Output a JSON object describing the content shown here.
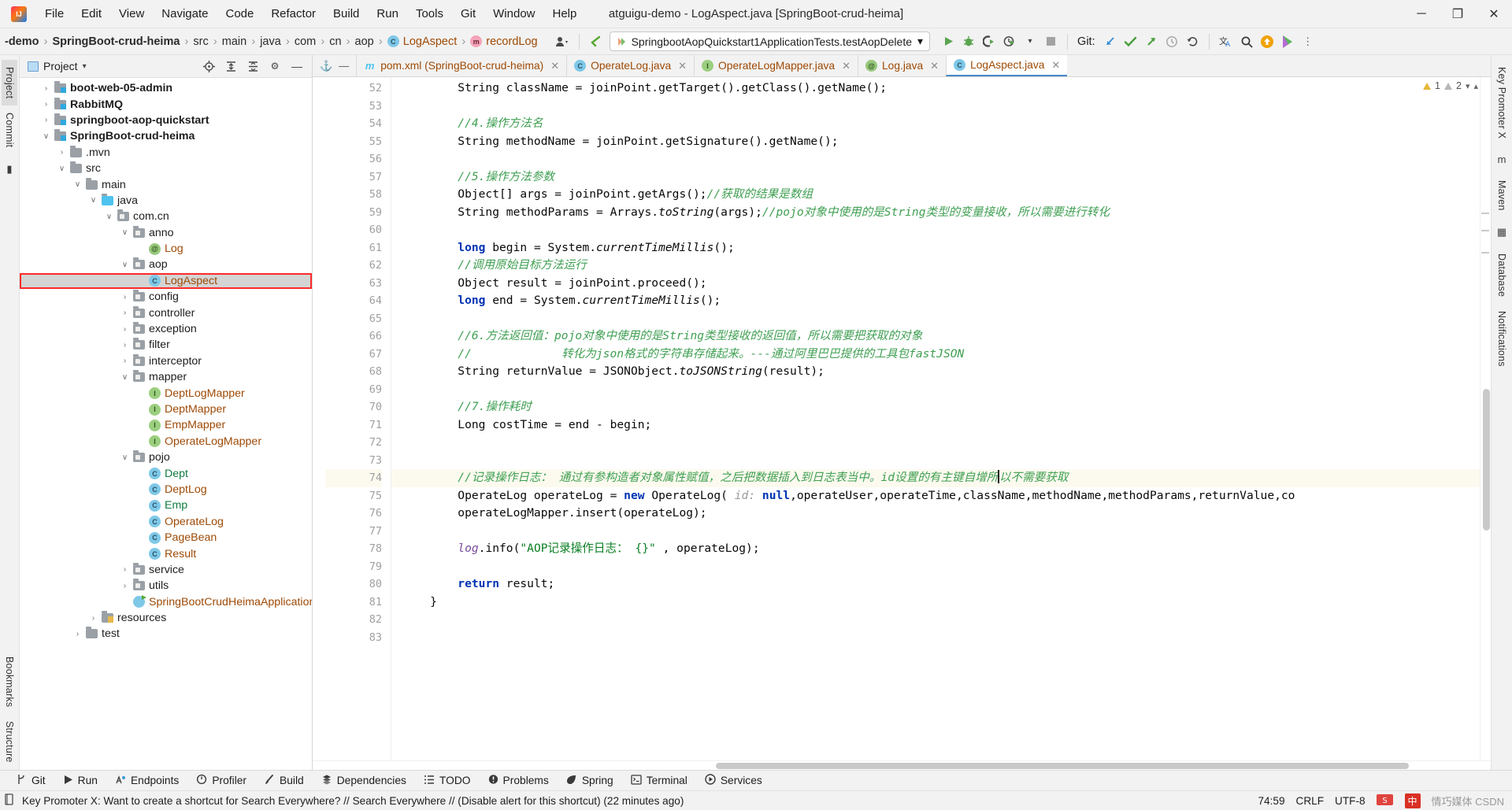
{
  "window": {
    "title": "atguigu-demo - LogAspect.java [SpringBoot-crud-heima]",
    "logo": "intellij-idea-logo",
    "controls": {
      "minimize": "─",
      "maximize": "❐",
      "close": "✕"
    }
  },
  "menubar": [
    "File",
    "Edit",
    "View",
    "Navigate",
    "Code",
    "Refactor",
    "Build",
    "Run",
    "Tools",
    "Git",
    "Window",
    "Help"
  ],
  "navbar": {
    "breadcrumbs": [
      {
        "label": "-demo",
        "bold": true,
        "icon": ""
      },
      {
        "label": "SpringBoot-crud-heima",
        "bold": true,
        "icon": ""
      },
      {
        "label": "src",
        "bold": false,
        "icon": ""
      },
      {
        "label": "main",
        "bold": false,
        "icon": ""
      },
      {
        "label": "java",
        "bold": false,
        "icon": ""
      },
      {
        "label": "com",
        "bold": false,
        "icon": ""
      },
      {
        "label": "cn",
        "bold": false,
        "icon": ""
      },
      {
        "label": "aop",
        "bold": false,
        "icon": ""
      },
      {
        "label": "LogAspect",
        "bold": false,
        "icon": "class-badge",
        "orange": true
      },
      {
        "label": "recordLog",
        "bold": false,
        "icon": "method-badge",
        "orange": true
      }
    ],
    "run_config": "SpringbootAopQuickstart1ApplicationTests.testAopDelete",
    "run_config_dropdown": "▾",
    "actions": [
      "run-icon",
      "debug-icon",
      "run-coverage-icon",
      "profiler-icon",
      "stop-icon"
    ],
    "git_label": "Git:",
    "git_actions": [
      "update-project-icon",
      "commit-icon",
      "push-icon",
      "history-icon",
      "rollback-icon"
    ],
    "right_actions": [
      "translate-icon",
      "search-everywhere-icon",
      "update-badge-icon",
      "ai-assistant-icon"
    ],
    "settings_icons": [
      "avatar-icon",
      "back-arrow-icon"
    ]
  },
  "left_rail": [
    "Project",
    "Commit"
  ],
  "left_rail_bottom": [
    "Bookmarks",
    "Structure"
  ],
  "right_rail": [
    "Key Promoter X",
    "Maven",
    "Database",
    "Notifications"
  ],
  "project_panel": {
    "title": "Project",
    "title_dropdown": "▾",
    "header_actions": [
      "locate-icon",
      "expand-all-icon",
      "collapse-all-icon",
      "settings-icon",
      "hide-icon"
    ],
    "tree": [
      {
        "depth": 1,
        "arrow": "›",
        "icon": "module",
        "label": "boot-web-05-admin",
        "bold": true
      },
      {
        "depth": 1,
        "arrow": "›",
        "icon": "module",
        "label": "RabbitMQ",
        "bold": true
      },
      {
        "depth": 1,
        "arrow": "›",
        "icon": "module",
        "label": "springboot-aop-quickstart",
        "bold": true
      },
      {
        "depth": 1,
        "arrow": "∨",
        "icon": "module",
        "label": "SpringBoot-crud-heima",
        "bold": true
      },
      {
        "depth": 2,
        "arrow": "›",
        "icon": "folder",
        "label": ".mvn"
      },
      {
        "depth": 2,
        "arrow": "∨",
        "icon": "folder",
        "label": "src"
      },
      {
        "depth": 3,
        "arrow": "∨",
        "icon": "folder",
        "label": "main"
      },
      {
        "depth": 4,
        "arrow": "∨",
        "icon": "source-folder",
        "label": "java"
      },
      {
        "depth": 5,
        "arrow": "∨",
        "icon": "package",
        "label": "com.cn"
      },
      {
        "depth": 6,
        "arrow": "∨",
        "icon": "package",
        "label": "anno"
      },
      {
        "depth": 7,
        "arrow": "",
        "icon": "annotation",
        "label": "Log",
        "color": "orange"
      },
      {
        "depth": 6,
        "arrow": "∨",
        "icon": "package",
        "label": "aop"
      },
      {
        "depth": 7,
        "arrow": "",
        "icon": "class",
        "label": "LogAspect",
        "color": "orange",
        "selected": true,
        "boxed": true
      },
      {
        "depth": 6,
        "arrow": "›",
        "icon": "package",
        "label": "config"
      },
      {
        "depth": 6,
        "arrow": "›",
        "icon": "package",
        "label": "controller"
      },
      {
        "depth": 6,
        "arrow": "›",
        "icon": "package",
        "label": "exception"
      },
      {
        "depth": 6,
        "arrow": "›",
        "icon": "package",
        "label": "filter"
      },
      {
        "depth": 6,
        "arrow": "›",
        "icon": "package",
        "label": "interceptor"
      },
      {
        "depth": 6,
        "arrow": "∨",
        "icon": "package",
        "label": "mapper"
      },
      {
        "depth": 7,
        "arrow": "",
        "icon": "interface",
        "label": "DeptLogMapper",
        "color": "orange"
      },
      {
        "depth": 7,
        "arrow": "",
        "icon": "interface",
        "label": "DeptMapper",
        "color": "orange"
      },
      {
        "depth": 7,
        "arrow": "",
        "icon": "interface",
        "label": "EmpMapper",
        "color": "orange"
      },
      {
        "depth": 7,
        "arrow": "",
        "icon": "interface",
        "label": "OperateLogMapper",
        "color": "orange"
      },
      {
        "depth": 6,
        "arrow": "∨",
        "icon": "package",
        "label": "pojo"
      },
      {
        "depth": 7,
        "arrow": "",
        "icon": "class",
        "label": "Dept",
        "color": "green"
      },
      {
        "depth": 7,
        "arrow": "",
        "icon": "class",
        "label": "DeptLog",
        "color": "orange"
      },
      {
        "depth": 7,
        "arrow": "",
        "icon": "class",
        "label": "Emp",
        "color": "green"
      },
      {
        "depth": 7,
        "arrow": "",
        "icon": "class",
        "label": "OperateLog",
        "color": "orange"
      },
      {
        "depth": 7,
        "arrow": "",
        "icon": "class",
        "label": "PageBean",
        "color": "orange"
      },
      {
        "depth": 7,
        "arrow": "",
        "icon": "class",
        "label": "Result",
        "color": "orange"
      },
      {
        "depth": 6,
        "arrow": "›",
        "icon": "package",
        "label": "service"
      },
      {
        "depth": 6,
        "arrow": "›",
        "icon": "package",
        "label": "utils"
      },
      {
        "depth": 6,
        "arrow": "",
        "icon": "spring-class",
        "label": "SpringBootCrudHeimaApplication",
        "color": "orange"
      },
      {
        "depth": 4,
        "arrow": "›",
        "icon": "resource-folder",
        "label": "resources"
      },
      {
        "depth": 3,
        "arrow": "›",
        "icon": "folder",
        "label": "test"
      }
    ]
  },
  "editor": {
    "tabs": [
      {
        "label": "pom.xml (SpringBoot-crud-heima)",
        "icon": "maven",
        "active": false,
        "close": "✕"
      },
      {
        "label": "OperateLog.java",
        "icon": "class",
        "active": false,
        "close": "✕"
      },
      {
        "label": "OperateLogMapper.java",
        "icon": "interface",
        "active": false,
        "close": "✕"
      },
      {
        "label": "Log.java",
        "icon": "annotation",
        "active": false,
        "close": "✕"
      },
      {
        "label": "LogAspect.java",
        "icon": "class",
        "active": true,
        "close": "✕"
      }
    ],
    "inspection": {
      "warnings": "1",
      "weak_warnings": "2",
      "warn_icon": "warning-triangle-icon",
      "weak_icon": "weak-warning-icon"
    },
    "first_line_number": 52,
    "current_line": 74,
    "lines": [
      {
        "n": 52,
        "segments": [
          {
            "t": "        String className = joinPoint.getTarget().getClass().getName();",
            "c": ""
          }
        ]
      },
      {
        "n": 53,
        "segments": [
          {
            "t": "",
            "c": ""
          }
        ]
      },
      {
        "n": 54,
        "segments": [
          {
            "t": "        ",
            "c": ""
          },
          {
            "t": "//4.操作方法名",
            "c": "cm"
          }
        ]
      },
      {
        "n": 55,
        "segments": [
          {
            "t": "        String methodName = joinPoint.getSignature().getName();",
            "c": ""
          }
        ]
      },
      {
        "n": 56,
        "segments": [
          {
            "t": "",
            "c": ""
          }
        ]
      },
      {
        "n": 57,
        "segments": [
          {
            "t": "        ",
            "c": ""
          },
          {
            "t": "//5.操作方法参数",
            "c": "cm"
          }
        ]
      },
      {
        "n": 58,
        "segments": [
          {
            "t": "        Object[] args = joinPoint.getArgs();",
            "c": ""
          },
          {
            "t": "//获取的结果是数组",
            "c": "cm"
          }
        ]
      },
      {
        "n": 59,
        "segments": [
          {
            "t": "        String methodParams = Arrays.",
            "c": ""
          },
          {
            "t": "toString",
            "c": "it"
          },
          {
            "t": "(args);",
            "c": ""
          },
          {
            "t": "//pojo对象中使用的是String类型的变量接收，所以需要进行转化",
            "c": "cm"
          }
        ]
      },
      {
        "n": 60,
        "segments": [
          {
            "t": "",
            "c": ""
          }
        ]
      },
      {
        "n": 61,
        "segments": [
          {
            "t": "        ",
            "c": ""
          },
          {
            "t": "long",
            "c": "kw"
          },
          {
            "t": " begin = System.",
            "c": ""
          },
          {
            "t": "currentTimeMillis",
            "c": "it"
          },
          {
            "t": "();",
            "c": ""
          }
        ]
      },
      {
        "n": 62,
        "segments": [
          {
            "t": "        ",
            "c": ""
          },
          {
            "t": "//调用原始目标方法运行",
            "c": "cm"
          }
        ]
      },
      {
        "n": 63,
        "segments": [
          {
            "t": "        Object result = joinPoint.proceed();",
            "c": ""
          }
        ]
      },
      {
        "n": 64,
        "segments": [
          {
            "t": "        ",
            "c": ""
          },
          {
            "t": "long",
            "c": "kw"
          },
          {
            "t": " end = System.",
            "c": ""
          },
          {
            "t": "currentTimeMillis",
            "c": "it"
          },
          {
            "t": "();",
            "c": ""
          }
        ]
      },
      {
        "n": 65,
        "segments": [
          {
            "t": "",
            "c": ""
          }
        ]
      },
      {
        "n": 66,
        "segments": [
          {
            "t": "        ",
            "c": ""
          },
          {
            "t": "//6.方法返回值：pojo对象中使用的是String类型接收的返回值，所以需要把获取的对象",
            "c": "cm"
          }
        ]
      },
      {
        "n": 67,
        "segments": [
          {
            "t": "        ",
            "c": ""
          },
          {
            "t": "//             转化为json格式的字符串存储起来。---通过阿里巴巴提供的工具包fastJSON",
            "c": "cm"
          }
        ]
      },
      {
        "n": 68,
        "segments": [
          {
            "t": "        String returnValue = JSONObject.",
            "c": ""
          },
          {
            "t": "toJSONString",
            "c": "it"
          },
          {
            "t": "(result);",
            "c": ""
          }
        ]
      },
      {
        "n": 69,
        "segments": [
          {
            "t": "",
            "c": ""
          }
        ]
      },
      {
        "n": 70,
        "segments": [
          {
            "t": "        ",
            "c": ""
          },
          {
            "t": "//7.操作耗时",
            "c": "cm"
          }
        ]
      },
      {
        "n": 71,
        "segments": [
          {
            "t": "        Long costTime = end - begin;",
            "c": ""
          }
        ]
      },
      {
        "n": 72,
        "segments": [
          {
            "t": "",
            "c": ""
          }
        ]
      },
      {
        "n": 73,
        "segments": [
          {
            "t": "",
            "c": ""
          }
        ]
      },
      {
        "n": 74,
        "current": true,
        "segments": [
          {
            "t": "        ",
            "c": ""
          },
          {
            "t": "//记录操作日志： 通过有参构造者对象属性赋值，之后把数据插入到日志表当中。id设置的有主键自增所",
            "c": "cm"
          },
          {
            "t": "|",
            "c": "caret"
          },
          {
            "t": "以不需要获取",
            "c": "cm"
          }
        ]
      },
      {
        "n": 75,
        "segments": [
          {
            "t": "        OperateLog operateLog = ",
            "c": ""
          },
          {
            "t": "new",
            "c": "kw"
          },
          {
            "t": " OperateLog( ",
            "c": ""
          },
          {
            "t": "id:",
            "c": "hint"
          },
          {
            "t": " ",
            "c": ""
          },
          {
            "t": "null",
            "c": "kw"
          },
          {
            "t": ",operateUser,operateTime,className,methodName,methodParams,returnValue,co",
            "c": ""
          }
        ]
      },
      {
        "n": 76,
        "segments": [
          {
            "t": "        operateLogMapper.insert(operateLog);",
            "c": ""
          }
        ]
      },
      {
        "n": 77,
        "segments": [
          {
            "t": "",
            "c": ""
          }
        ]
      },
      {
        "n": 78,
        "segments": [
          {
            "t": "        ",
            "c": ""
          },
          {
            "t": "log",
            "c": "fld"
          },
          {
            "t": ".info(",
            "c": ""
          },
          {
            "t": "\"AOP记录操作日志： {}\"",
            "c": "st"
          },
          {
            "t": " , operateLog);",
            "c": ""
          }
        ]
      },
      {
        "n": 79,
        "segments": [
          {
            "t": "",
            "c": ""
          }
        ]
      },
      {
        "n": 80,
        "segments": [
          {
            "t": "        ",
            "c": ""
          },
          {
            "t": "return",
            "c": "kw"
          },
          {
            "t": " result;",
            "c": ""
          }
        ]
      },
      {
        "n": 81,
        "segments": [
          {
            "t": "    }",
            "c": ""
          }
        ]
      },
      {
        "n": 82,
        "segments": [
          {
            "t": "",
            "c": ""
          }
        ]
      },
      {
        "n": 83,
        "segments": [
          {
            "t": "",
            "c": ""
          }
        ]
      }
    ]
  },
  "toolwindows": [
    {
      "label": "Git",
      "icon": "git-branch-icon"
    },
    {
      "label": "Run",
      "icon": "run-icon"
    },
    {
      "label": "Endpoints",
      "icon": "endpoints-icon"
    },
    {
      "label": "Profiler",
      "icon": "profiler-icon"
    },
    {
      "label": "Build",
      "icon": "build-hammer-icon"
    },
    {
      "label": "Dependencies",
      "icon": "dependencies-icon"
    },
    {
      "label": "TODO",
      "icon": "todo-list-icon"
    },
    {
      "label": "Problems",
      "icon": "problems-icon"
    },
    {
      "label": "Spring",
      "icon": "spring-leaf-icon"
    },
    {
      "label": "Terminal",
      "icon": "terminal-icon"
    },
    {
      "label": "Services",
      "icon": "services-icon"
    }
  ],
  "statusbar": {
    "icon": "event-log-icon",
    "message": "Key Promoter X: Want to create a shortcut for Search Everywhere? // Search Everywhere // (Disable alert for this shortcut) (22 minutes ago)",
    "position": "74:59",
    "line_separator": "CRLF",
    "encoding": "UTF-8",
    "ime_lang": "中",
    "watermark": "情巧媒体 CSDN"
  },
  "colors": {
    "accent": "#4a88c7",
    "selection": "#d4d4d4",
    "highlight_box": "#ff2a2a",
    "comment": "#3f9f52",
    "keyword": "#0033b3",
    "string": "#0a7d22",
    "class_orange": "#9e4a06",
    "class_green": "#107c41",
    "current_line": "#fcfaef"
  }
}
